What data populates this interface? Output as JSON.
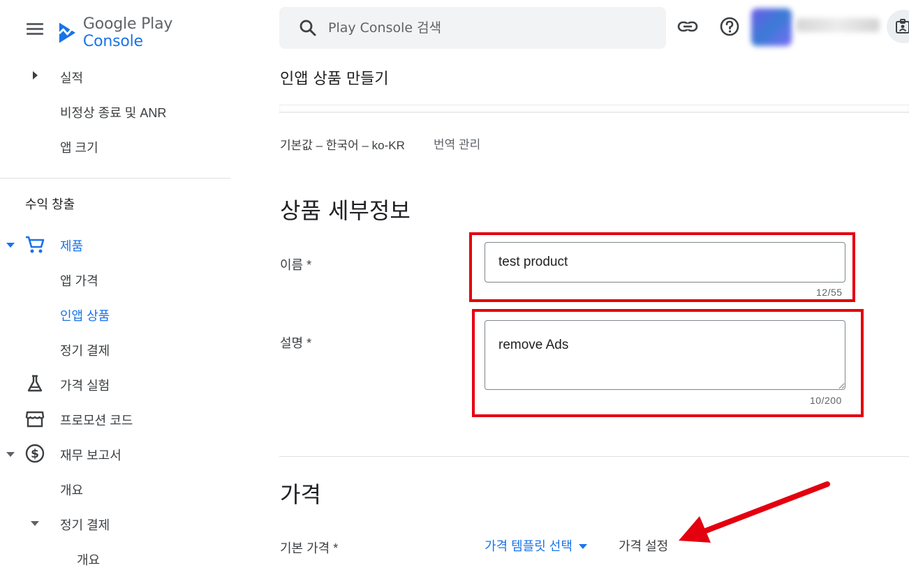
{
  "app": {
    "brand_name": "Google Play",
    "brand_accent": "Console"
  },
  "search": {
    "placeholder": "Play Console 검색"
  },
  "sidebar": {
    "items_top": [
      {
        "label": "실적"
      },
      {
        "label": "비정상 종료 및 ANR"
      },
      {
        "label": "앱 크기"
      }
    ],
    "section_label": "수익 창출",
    "products": {
      "label": "제품",
      "children": [
        {
          "label": "앱 가격"
        },
        {
          "label": "인앱 상품"
        },
        {
          "label": "정기 결제"
        }
      ]
    },
    "price_experiments": "가격 실험",
    "promo_codes": "프로모션 코드",
    "financial_reports": {
      "label": "재무 보고서",
      "overview": "개요",
      "subscriptions": {
        "label": "정기 결제",
        "overview": "개요"
      }
    }
  },
  "main": {
    "page_title": "인앱 상품 만들기",
    "language": {
      "default_label": "기본값 – 한국어 – ko-KR",
      "manage_link": "번역 관리"
    },
    "details": {
      "heading": "상품 세부정보",
      "name_label": "이름 *",
      "name_value": "test product",
      "name_counter": "12/55",
      "description_label": "설명 *",
      "description_value": "remove Ads",
      "description_counter": "10/200"
    },
    "pricing": {
      "heading": "가격",
      "base_price_label": "기본 가격 *",
      "template_select": "가격 템플릿 선택",
      "set_price": "가격 설정"
    }
  },
  "colors": {
    "accent": "#1a73e8",
    "annotation_red": "#e3000f",
    "text_primary": "#202124",
    "text_secondary": "#5f6368"
  }
}
